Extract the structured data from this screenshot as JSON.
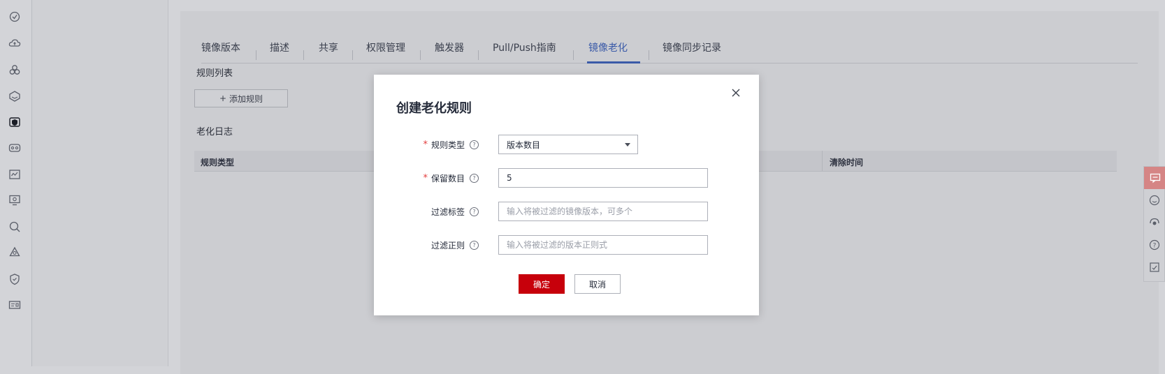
{
  "sidebar": {
    "icons": [
      "gear-badge-icon",
      "cloud-upload-icon",
      "cluster-icon",
      "stack-icon",
      "shield-box-icon",
      "vr-headset-icon",
      "chart-card-icon",
      "monitor-refresh-icon",
      "search-icon",
      "network-nodes-icon",
      "shield-check-icon",
      "id-card-icon"
    ],
    "active_index": 4
  },
  "tabs": [
    {
      "label": "镜像版本"
    },
    {
      "label": "描述"
    },
    {
      "label": "共享"
    },
    {
      "label": "权限管理"
    },
    {
      "label": "触发器"
    },
    {
      "label": "Pull/Push指南"
    },
    {
      "label": "镜像老化"
    },
    {
      "label": "镜像同步记录"
    }
  ],
  "active_tab": "镜像老化",
  "rules": {
    "title": "规则列表",
    "add_button": "添加规则"
  },
  "log": {
    "title": "老化日志",
    "columns": [
      "规则类型",
      "清除时间"
    ]
  },
  "modal": {
    "title": "创建老化规则",
    "rule_type_label": "规则类型",
    "rule_type_value": "版本数目",
    "keep_count_label": "保留数目",
    "keep_count_value": "5",
    "filter_tag_label": "过滤标签",
    "filter_tag_placeholder": "输入将被过滤的镜像版本，可多个",
    "filter_regex_label": "过滤正则",
    "filter_regex_placeholder": "输入将被过滤的版本正则式",
    "ok_label": "确定",
    "cancel_label": "取消"
  },
  "colors": {
    "primary_red": "#c7000b",
    "tab_active": "#3a5aa8",
    "required_star": "#e33d3d"
  }
}
